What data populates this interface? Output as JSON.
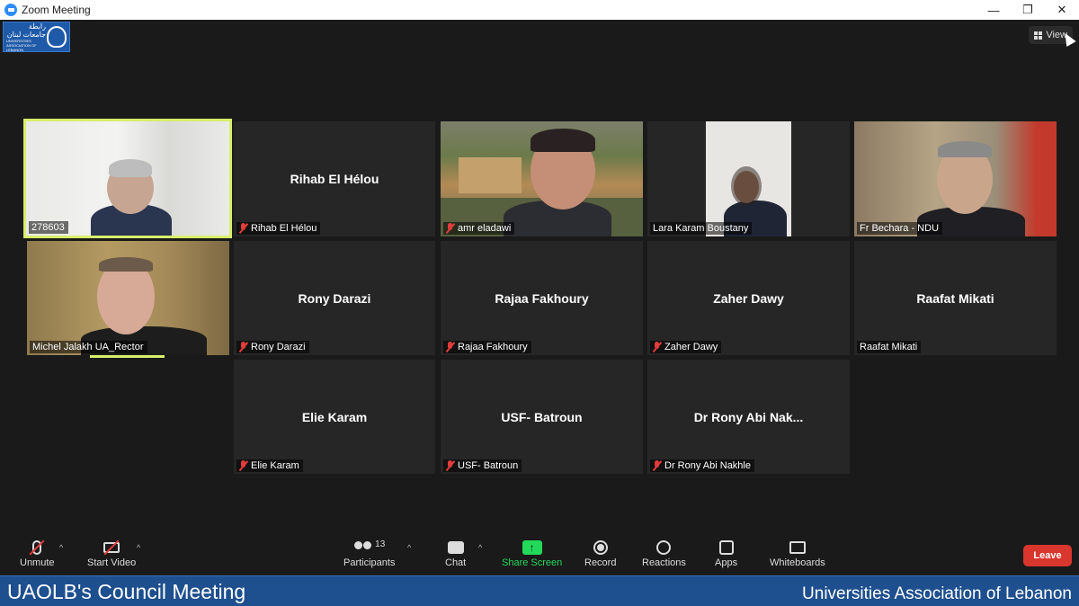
{
  "window": {
    "title": "Zoom Meeting",
    "controls": [
      "—",
      "❐",
      "✕"
    ]
  },
  "logo": {
    "text_ar": "رابطة جامعات لبنان",
    "text_en": "UNIVERSITIES ASSOCIATION OF LEBANON"
  },
  "view_button": {
    "label": "View"
  },
  "participants": [
    {
      "name": "278603",
      "has_video": true,
      "muted": false
    },
    {
      "name": "Rihab El Hélou",
      "display": "Rihab El Hélou",
      "has_video": false,
      "muted": true
    },
    {
      "name": "amr eladawi",
      "has_video": true,
      "muted": true
    },
    {
      "name": "Lara Karam Boustany",
      "has_video": true,
      "muted": false
    },
    {
      "name": "Fr Bechara - NDU",
      "has_video": true,
      "muted": false
    },
    {
      "name": "Michel Jalakh UA_Rector",
      "has_video": true,
      "muted": false
    },
    {
      "name": "Rony Darazi",
      "display": "Rony Darazi",
      "has_video": false,
      "muted": true
    },
    {
      "name": "Rajaa Fakhoury",
      "display": "Rajaa Fakhoury",
      "has_video": false,
      "muted": true
    },
    {
      "name": "Zaher Dawy",
      "display": "Zaher Dawy",
      "has_video": false,
      "muted": true
    },
    {
      "name": "Raafat Mikati",
      "display": "Raafat Mikati",
      "has_video": false,
      "muted": false
    },
    {
      "name": "Elie Karam",
      "display": "Elie Karam",
      "has_video": false,
      "muted": true
    },
    {
      "name": "USF- Batroun",
      "display": "USF- Batroun",
      "has_video": false,
      "muted": true
    },
    {
      "name": "Dr Rony Abi Nakhle",
      "display": "Dr Rony Abi Nak...",
      "has_video": false,
      "muted": true
    }
  ],
  "toolbar": {
    "unmute": "Unmute",
    "start_video": "Start Video",
    "participants": "Participants",
    "participants_count": "13",
    "chat": "Chat",
    "share_screen": "Share Screen",
    "record": "Record",
    "reactions": "Reactions",
    "apps": "Apps",
    "whiteboards": "Whiteboards",
    "leave": "Leave",
    "caret": "^"
  },
  "banner": {
    "left": "UAOLB's Council Meeting",
    "right": "Universities Association of Lebanon"
  },
  "colors": {
    "active_speaker": "#d7ef6a",
    "share_green": "#23d959",
    "leave_red": "#d9362e",
    "banner_blue": "#1e4f8e",
    "mute_red": "#e23c3c"
  }
}
